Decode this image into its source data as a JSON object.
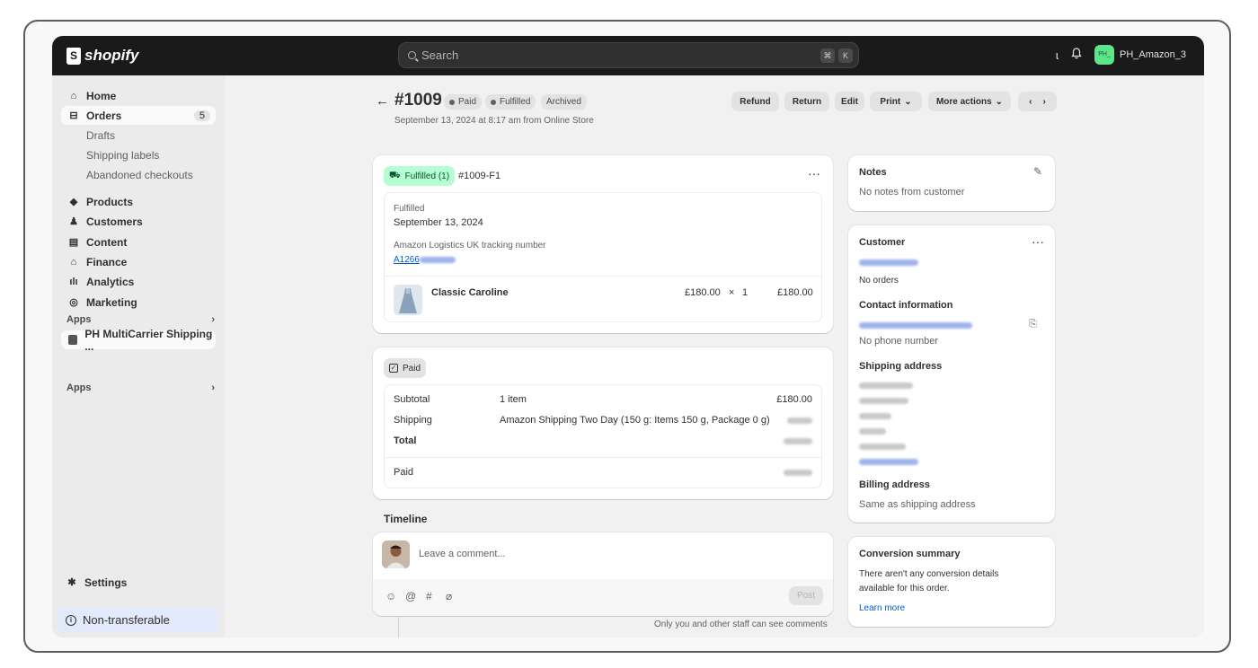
{
  "topbar": {
    "brand": "shopify",
    "search_placeholder": "Search",
    "kbd_cmd": "⌘",
    "kbd_k": "K",
    "store_initials": "PH_",
    "store_name": "PH_Amazon_3"
  },
  "sidebar": {
    "home": "Home",
    "orders": "Orders",
    "orders_count": "5",
    "drafts": "Drafts",
    "shipping_labels": "Shipping labels",
    "abandoned": "Abandoned checkouts",
    "products": "Products",
    "customers": "Customers",
    "content": "Content",
    "finance": "Finance",
    "analytics": "Analytics",
    "marketing": "Marketing",
    "apps_label": "Apps",
    "app_item": "PH MultiCarrier Shipping ...",
    "apps_label2": "Apps",
    "settings": "Settings",
    "non_transferable": "Non-transferable"
  },
  "header": {
    "order_number": "#1009",
    "status_paid": "Paid",
    "status_fulfilled": "Fulfilled",
    "status_archived": "Archived",
    "date": "September 13, 2024 at 8:17 am from Online Store",
    "actions": {
      "refund": "Refund",
      "return": "Return",
      "edit": "Edit",
      "print": "Print",
      "more": "More actions"
    }
  },
  "fulfillment": {
    "badge": "Fulfilled (1)",
    "id": "#1009-F1",
    "status": "Fulfilled",
    "date": "September 13, 2024",
    "tracking_label": "Amazon Logistics UK tracking number",
    "tracking_prefix": "A1266",
    "item_name": "Classic Caroline",
    "item_price": "£180.00",
    "item_times": "×",
    "item_qty": "1",
    "item_total": "£180.00"
  },
  "payment": {
    "badge": "Paid",
    "subtotal_label": "Subtotal",
    "subtotal_items": "1 item",
    "subtotal_value": "£180.00",
    "shipping_label": "Shipping",
    "shipping_desc": "Amazon Shipping Two Day (150 g: Items 150 g, Package 0 g)",
    "total_label": "Total",
    "paid_label": "Paid"
  },
  "timeline": {
    "title": "Timeline",
    "comment_placeholder": "Leave a comment...",
    "post": "Post",
    "note": "Only you and other staff can see comments"
  },
  "notes": {
    "title": "Notes",
    "text": "No notes from customer"
  },
  "customer": {
    "title": "Customer",
    "orders": "No orders",
    "contact_title": "Contact information",
    "no_phone": "No phone number",
    "shipping_title": "Shipping address",
    "billing_title": "Billing address",
    "billing_text": "Same as shipping address"
  },
  "conversion": {
    "title": "Conversion summary",
    "text1": "There aren't any conversion details",
    "text2": "available for this order.",
    "link": "Learn more"
  }
}
